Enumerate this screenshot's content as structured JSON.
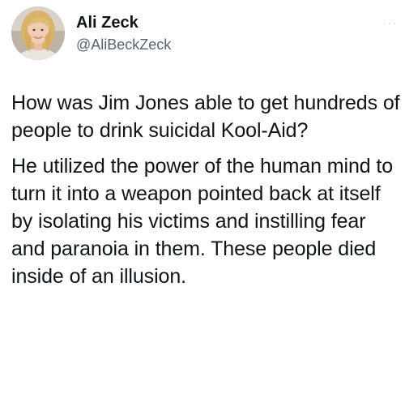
{
  "author": {
    "display_name": "Ali Zeck",
    "handle": "@AliBeckZeck"
  },
  "menu": {
    "icon": "more-dots-icon",
    "glyph": "···"
  },
  "tweet": {
    "paragraphs": [
      "How was Jim Jones able to get hundreds of people to drink suicidal Kool-Aid?",
      "He utilized the power of the human mind to turn it into a weapon pointed back at itself by isolating his victims and instilling fear and paranoia in them. These people died inside of an illusion."
    ]
  },
  "colors": {
    "text": "#0f1419",
    "handle": "#536471",
    "background": "#ffffff"
  }
}
